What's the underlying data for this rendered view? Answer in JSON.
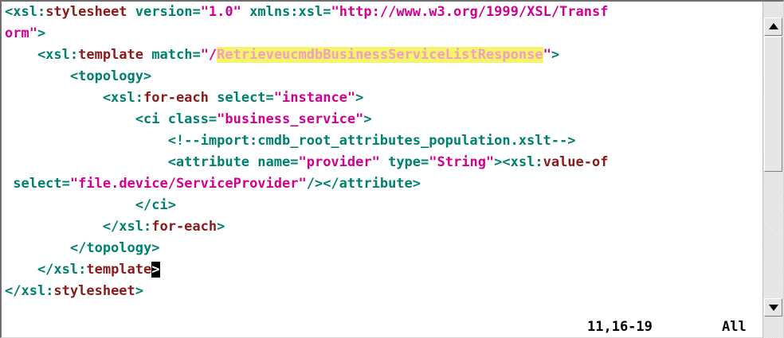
{
  "editor": {
    "lines": [
      [
        {
          "text": "<xsl:",
          "cls": "teal"
        },
        {
          "text": "stylesheet",
          "cls": "maroon"
        },
        {
          "text": " version",
          "cls": "teal"
        },
        {
          "text": "=",
          "cls": "teal"
        },
        {
          "text": "\"1.0\"",
          "cls": "magenta"
        },
        {
          "text": " xmlns:xsl",
          "cls": "teal"
        },
        {
          "text": "=",
          "cls": "teal"
        },
        {
          "text": "\"http://www.w3.org/1999/XSL/Transf",
          "cls": "magenta"
        }
      ],
      [
        {
          "text": "orm\"",
          "cls": "magenta"
        },
        {
          "text": ">",
          "cls": "teal"
        }
      ],
      [
        {
          "text": "    <xsl:",
          "cls": "teal"
        },
        {
          "text": "template",
          "cls": "maroon"
        },
        {
          "text": " match",
          "cls": "teal"
        },
        {
          "text": "=",
          "cls": "teal"
        },
        {
          "text": "\"/",
          "cls": "magenta"
        },
        {
          "text": "RetrieveucmdbBusinessServiceListResponse",
          "cls": "hl"
        },
        {
          "text": "\"",
          "cls": "magenta"
        },
        {
          "text": ">",
          "cls": "teal"
        }
      ],
      [
        {
          "text": "        <topology>",
          "cls": "teal"
        }
      ],
      [
        {
          "text": "            <xsl:",
          "cls": "teal"
        },
        {
          "text": "for-each",
          "cls": "maroon"
        },
        {
          "text": " select",
          "cls": "teal"
        },
        {
          "text": "=",
          "cls": "teal"
        },
        {
          "text": "\"instance\"",
          "cls": "magenta"
        },
        {
          "text": ">",
          "cls": "teal"
        }
      ],
      [
        {
          "text": "                <ci class",
          "cls": "teal"
        },
        {
          "text": "=",
          "cls": "teal"
        },
        {
          "text": "\"business_service\"",
          "cls": "magenta"
        },
        {
          "text": ">",
          "cls": "teal"
        }
      ],
      [
        {
          "text": "                    <!--import:cmdb_root_attributes_population.xslt-->",
          "cls": "teal"
        }
      ],
      [
        {
          "text": "                    <attribute name",
          "cls": "teal"
        },
        {
          "text": "=",
          "cls": "teal"
        },
        {
          "text": "\"provider\"",
          "cls": "magenta"
        },
        {
          "text": " type",
          "cls": "teal"
        },
        {
          "text": "=",
          "cls": "teal"
        },
        {
          "text": "\"String\"",
          "cls": "magenta"
        },
        {
          "text": "><xsl:",
          "cls": "teal"
        },
        {
          "text": "value-of",
          "cls": "maroon"
        }
      ],
      [
        {
          "text": " select",
          "cls": "teal"
        },
        {
          "text": "=",
          "cls": "teal"
        },
        {
          "text": "\"file.device/ServiceProvider\"",
          "cls": "magenta"
        },
        {
          "text": "/></attribute>",
          "cls": "teal"
        }
      ],
      [
        {
          "text": "                </ci>",
          "cls": "teal"
        }
      ],
      [
        {
          "text": "            </xsl:",
          "cls": "teal"
        },
        {
          "text": "for-each",
          "cls": "maroon"
        },
        {
          "text": ">",
          "cls": "teal"
        }
      ],
      [
        {
          "text": "        </topology>",
          "cls": "teal"
        }
      ],
      [
        {
          "text": "    </xsl:",
          "cls": "teal"
        },
        {
          "text": "template",
          "cls": "maroon"
        },
        {
          "text": ">",
          "cls": "cursor"
        }
      ],
      [
        {
          "text": "</xsl:",
          "cls": "teal"
        },
        {
          "text": "stylesheet",
          "cls": "maroon"
        },
        {
          "text": ">",
          "cls": "teal"
        }
      ]
    ]
  },
  "status": {
    "position": "11,16-19",
    "scroll": "All"
  },
  "colors": {
    "tag": "#00806e",
    "keyword": "#8b1a1a",
    "string": "#d00090",
    "highlight_bg": "#f5f56a"
  },
  "icons": {
    "scroll_up": "scroll-up-arrow-icon",
    "scroll_down": "scroll-down-arrow-icon"
  }
}
